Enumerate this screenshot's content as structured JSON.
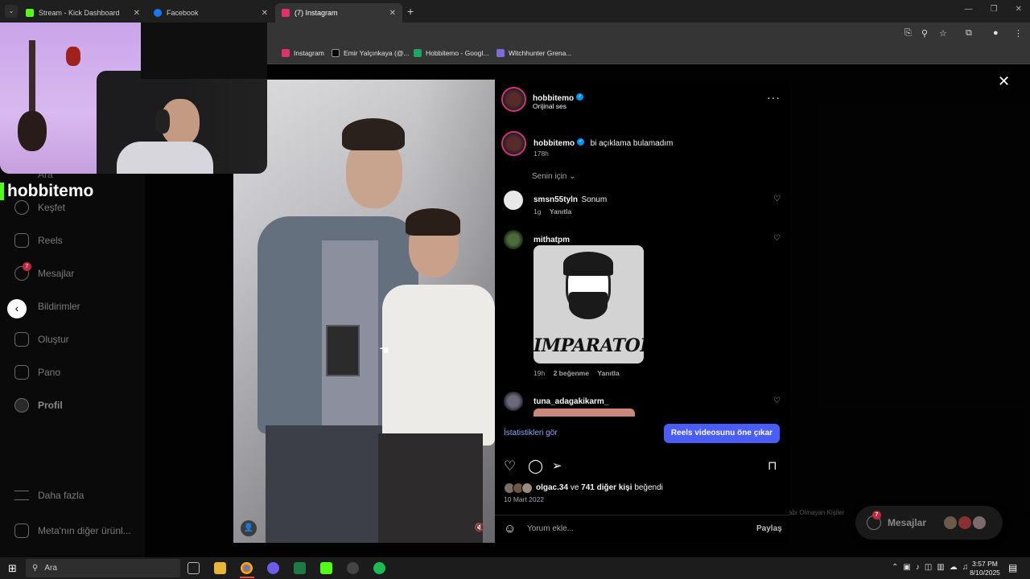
{
  "browser": {
    "tabs": [
      {
        "title": "Stream - Kick Dashboard",
        "color": "#53fc18",
        "active": false
      },
      {
        "title": "Facebook",
        "color": "#1877f2",
        "active": false
      },
      {
        "title": "(7) Instagram",
        "color": "#e1306c",
        "active": true
      }
    ],
    "new_tab": "+",
    "bookmarks": [
      {
        "label": "Instagram",
        "color": "#e1306c"
      },
      {
        "label": "Emir Yalçınkaya (@...",
        "color": "#ffffff"
      },
      {
        "label": "Hobbitemo - Googl...",
        "color": "#1fa463"
      },
      {
        "label": "Witchhunter Grena...",
        "color": "#7b6cd9"
      }
    ]
  },
  "sidebar": {
    "search_label": "Ara",
    "brand": "hobbitemo",
    "items": [
      {
        "label": "Keşfet",
        "icon": "compass-icon"
      },
      {
        "label": "Reels",
        "icon": "reels-icon"
      },
      {
        "label": "Mesajlar",
        "icon": "messenger-icon",
        "badge": "7"
      },
      {
        "label": "Bildirimler",
        "icon": "heart-icon"
      },
      {
        "label": "Oluştur",
        "icon": "plus-square-icon"
      },
      {
        "label": "Pano",
        "icon": "dashboard-icon"
      },
      {
        "label": "Profil",
        "icon": "profile-icon"
      },
      {
        "label": "Daha fazla",
        "icon": "menu-icon"
      },
      {
        "label": "Meta'nın diğer ürünl...",
        "icon": "meta-grid-icon"
      }
    ]
  },
  "post": {
    "author": "hobbitemo",
    "audio": "Orijinal ses",
    "caption": "bi açıklama bulamadım",
    "caption_age": "178h",
    "filter_label": "Senin için",
    "comments": [
      {
        "user": "smsn55tyln",
        "text": "Sonum",
        "age": "1g",
        "reply": "Yanıtla"
      },
      {
        "user": "mithatpm",
        "text": "",
        "age": "19h",
        "likes": "2 beğenme",
        "reply": "Yanıtla",
        "image_text": "IMPARATOR"
      },
      {
        "user": "tuna_adagakikarm_",
        "text": ""
      }
    ],
    "stats_link": "İstatistikleri gör",
    "promote_button": "Reels videosunu öne çıkar",
    "likes_user": "olgac.34",
    "likes_connector": "ve",
    "likes_others": "741 diğer kişi",
    "likes_suffix": "beğendi",
    "date": "10 Mart 2022",
    "comment_placeholder": "Yorum ekle...",
    "post_button": "Paylaş"
  },
  "background_page": {
    "hidden_text": "abı Olmayan Kişiler",
    "messages_float_label": "Mesajlar",
    "messages_badge": "7"
  },
  "taskbar": {
    "search": "Ara",
    "time": "3:57 PM",
    "date": "8/10/2025"
  }
}
